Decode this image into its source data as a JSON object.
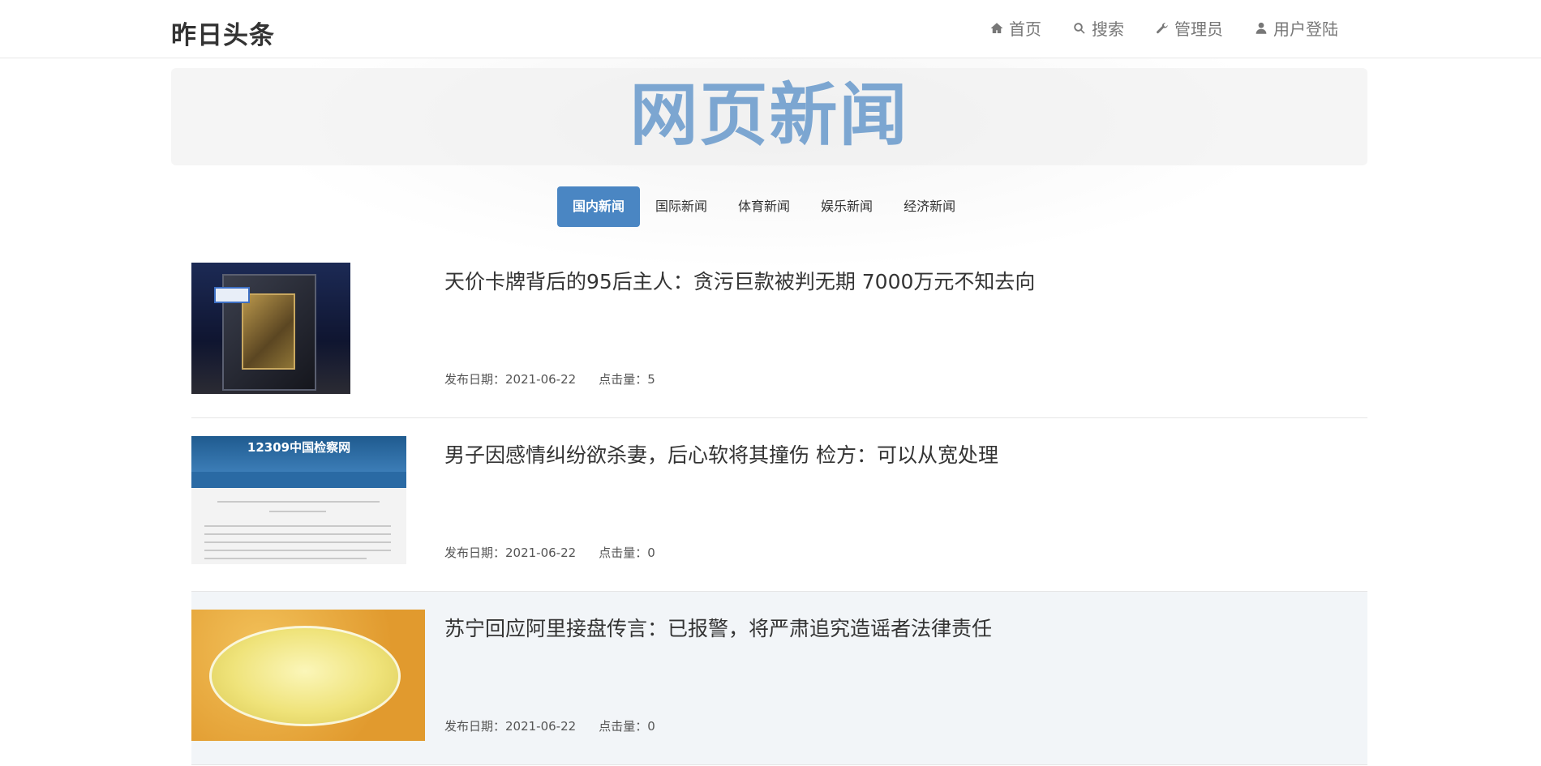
{
  "brand": "昨日头条",
  "nav": [
    {
      "icon": "home-icon",
      "label": "首页"
    },
    {
      "icon": "search-icon",
      "label": "搜索"
    },
    {
      "icon": "wrench-icon",
      "label": "管理员"
    },
    {
      "icon": "user-icon",
      "label": "用户登陆"
    }
  ],
  "jumbotron": {
    "title": "网页新闻"
  },
  "tabs": [
    {
      "label": "国内新闻",
      "active": true
    },
    {
      "label": "国际新闻",
      "active": false
    },
    {
      "label": "体育新闻",
      "active": false
    },
    {
      "label": "娱乐新闻",
      "active": false
    },
    {
      "label": "经济新闻",
      "active": false
    }
  ],
  "news": [
    {
      "title": "天价卡牌背后的95后主人：贪污巨款被判无期 7000万元不知去向",
      "date": "发布日期：2021-06-22",
      "clicks": "点击量：5"
    },
    {
      "title": "男子因感情纠纷欲杀妻，后心软将其撞伤 检方：可以从宽处理",
      "date": "发布日期：2021-06-22",
      "clicks": "点击量：0",
      "thumb_header": "12309中国检察网"
    },
    {
      "title": "苏宁回应阿里接盘传言：已报警，将严肃追究造谣者法律责任",
      "date": "发布日期：2021-06-22",
      "clicks": "点击量：0"
    }
  ],
  "colors": {
    "accent": "#4a86c3",
    "jumbo_title": "#7ca6d1",
    "highlight_row": "#f2f5f8"
  }
}
